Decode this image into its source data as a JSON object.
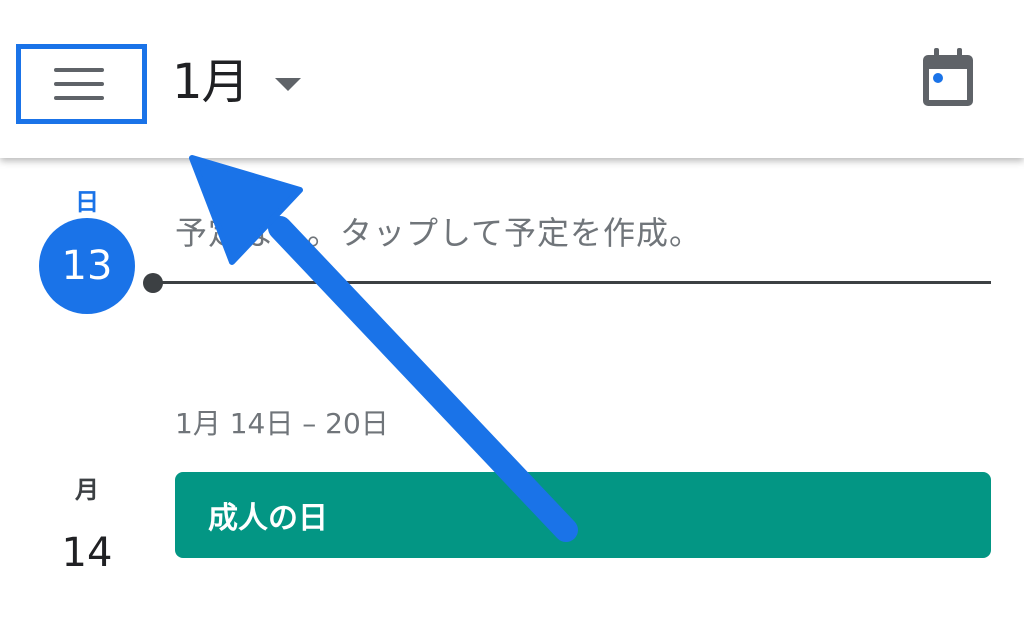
{
  "header": {
    "menu_icon": "hamburger-menu-icon",
    "month_label": "1月",
    "dropdown_icon": "caret-down-icon",
    "today_icon": "calendar-today-icon"
  },
  "days": [
    {
      "weekday": "日",
      "date": "13",
      "is_today": true,
      "empty_message": "予定なし。タップして予定を作成。"
    },
    {
      "weekday": "月",
      "date": "14",
      "events": [
        {
          "title": "成人の日"
        }
      ]
    }
  ],
  "week_range": "1月 14日 – 20日",
  "colors": {
    "accent": "#1a73e8",
    "event": "#039684",
    "annotation": "#1a73e8"
  }
}
